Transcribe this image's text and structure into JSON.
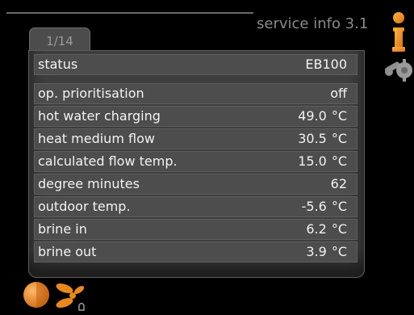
{
  "header": {
    "title": "service info 3.1"
  },
  "page_indicator": "1/14",
  "status_row": {
    "label": "status",
    "value": "EB100"
  },
  "rows": [
    {
      "label": "op. prioritisation",
      "value": "off",
      "unit": ""
    },
    {
      "label": "hot water charging",
      "value": "49.0",
      "unit": "°C"
    },
    {
      "label": "heat medium flow",
      "value": "30.5",
      "unit": "°C"
    },
    {
      "label": "calculated flow temp.",
      "value": "15.0",
      "unit": "°C"
    },
    {
      "label": "degree minutes",
      "value": "62",
      "unit": ""
    },
    {
      "label": "outdoor temp.",
      "value": "-5.6",
      "unit": "°C"
    },
    {
      "label": "brine in",
      "value": "6.2",
      "unit": "°C"
    },
    {
      "label": "brine out",
      "value": "3.9",
      "unit": "°C"
    }
  ],
  "icons": {
    "right": [
      "info-icon",
      "tools-icon"
    ],
    "bottom": [
      "heating-circle-icon",
      "fan-icon"
    ]
  },
  "colors": {
    "accent": "#e8891f",
    "background": "#000000",
    "panel": "#3e3e3e",
    "row": "#4d4d4d"
  }
}
